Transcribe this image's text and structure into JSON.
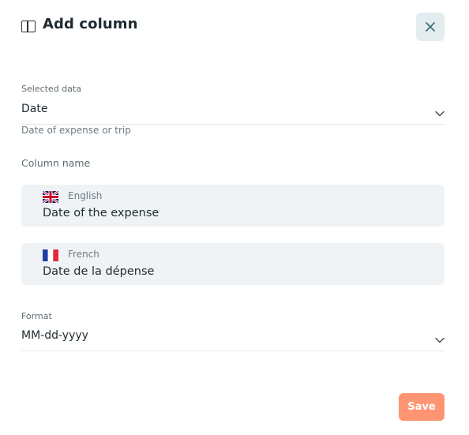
{
  "header": {
    "icon": "columns-icon",
    "title": "Add column",
    "close_icon": "close-icon"
  },
  "selected_data": {
    "label": "Selected data",
    "value": "Date",
    "helper": "Date of expense or trip"
  },
  "column_name": {
    "label": "Column name",
    "languages": [
      {
        "flag": "uk-flag-icon",
        "name": "English",
        "value": "Date of the expense"
      },
      {
        "flag": "france-flag-icon",
        "name": "French",
        "value": "Date de la dépense"
      }
    ]
  },
  "format": {
    "label": "Format",
    "value": "MM-dd-yyyy"
  },
  "actions": {
    "save_label": "Save",
    "save_color": "#ff9472"
  },
  "colors": {
    "close_bg": "#e3ecef",
    "input_bg": "#eff3f6"
  }
}
